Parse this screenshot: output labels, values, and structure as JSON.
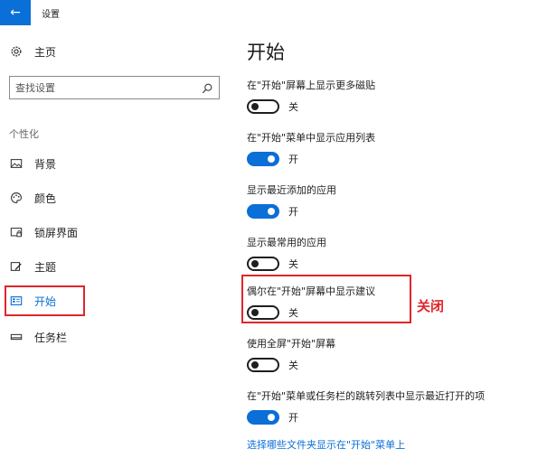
{
  "window": {
    "title": "设置",
    "back_icon": "←"
  },
  "sidebar": {
    "home_label": "主页",
    "search": {
      "placeholder": "查找设置"
    },
    "section_label": "个性化",
    "items": [
      {
        "label": "背景",
        "icon": "image-icon"
      },
      {
        "label": "颜色",
        "icon": "palette-icon"
      },
      {
        "label": "锁屏界面",
        "icon": "lock-screen-icon"
      },
      {
        "label": "主题",
        "icon": "theme-icon"
      },
      {
        "label": "开始",
        "icon": "start-icon",
        "selected": true
      },
      {
        "label": "任务栏",
        "icon": "taskbar-icon"
      }
    ]
  },
  "main": {
    "title": "开始",
    "settings": [
      {
        "label": "在\"开始\"屏幕上显示更多磁贴",
        "state": "关",
        "on": false
      },
      {
        "label": "在\"开始\"菜单中显示应用列表",
        "state": "开",
        "on": true
      },
      {
        "label": "显示最近添加的应用",
        "state": "开",
        "on": true
      },
      {
        "label": "显示最常用的应用",
        "state": "关",
        "on": false
      },
      {
        "label": "偶尔在\"开始\"屏幕中显示建议",
        "state": "关",
        "on": false
      },
      {
        "label": "使用全屏\"开始\"屏幕",
        "state": "关",
        "on": false
      },
      {
        "label": "在\"开始\"菜单或任务栏的跳转列表中显示最近打开的项",
        "state": "开",
        "on": true
      }
    ],
    "link": "选择哪些文件夹显示在\"开始\"菜单上"
  },
  "annotation": "关闭",
  "colors": {
    "accent": "#0a6fd6",
    "highlight": "#e0262b"
  }
}
